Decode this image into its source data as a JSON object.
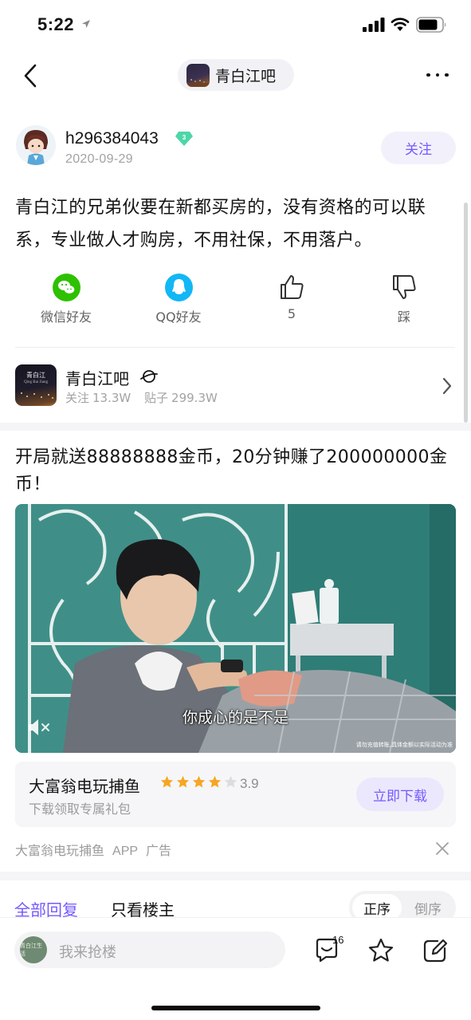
{
  "status_bar": {
    "time": "5:22"
  },
  "nav": {
    "forum_name": "青白江吧"
  },
  "post": {
    "author": "h296384043",
    "level": "3",
    "date": "2020-09-29",
    "follow_label": "关注",
    "body": "青白江的兄弟伙要在新都买房的，没有资格的可以联系，专业做人才购房，不用社保，不用落户。"
  },
  "share": {
    "wechat_label": "微信好友",
    "qq_label": "QQ好友",
    "like_count": "5",
    "dislike_label": "踩"
  },
  "forum_card": {
    "name": "青白江吧",
    "avatar_text": "青白江",
    "avatar_subtext": "Qing Bai Jiang",
    "followers_label": "关注",
    "followers": "13.3W",
    "posts_label": "贴子",
    "posts": "299.3W"
  },
  "ad": {
    "title": "开局就送88888888金币，20分钟赚了200000000金币！",
    "video_subtitle": "你成心的是不是",
    "video_disclaimer": "请勿充值转账,具体金额以实际活动为准",
    "app_name": "大富翁电玩捕鱼",
    "rating": "3.9",
    "stars_filled": 4,
    "stars_total": 5,
    "app_sub": "下载领取专属礼包",
    "download_label": "立即下载",
    "footer_app": "大富翁电玩捕鱼",
    "footer_type": "APP",
    "footer_tag": "广告"
  },
  "replies": {
    "tab_all": "全部回复",
    "tab_op": "只看楼主",
    "order_asc": "正序",
    "order_desc": "倒序"
  },
  "bottom_bar": {
    "reply_placeholder": "我来抢楼",
    "reply_avatar_text": "青白江生活",
    "comment_count": "16"
  },
  "colors": {
    "accent": "#7559ff",
    "wechat": "#2dc100",
    "qq": "#12b7f5",
    "star": "#f5a623"
  }
}
